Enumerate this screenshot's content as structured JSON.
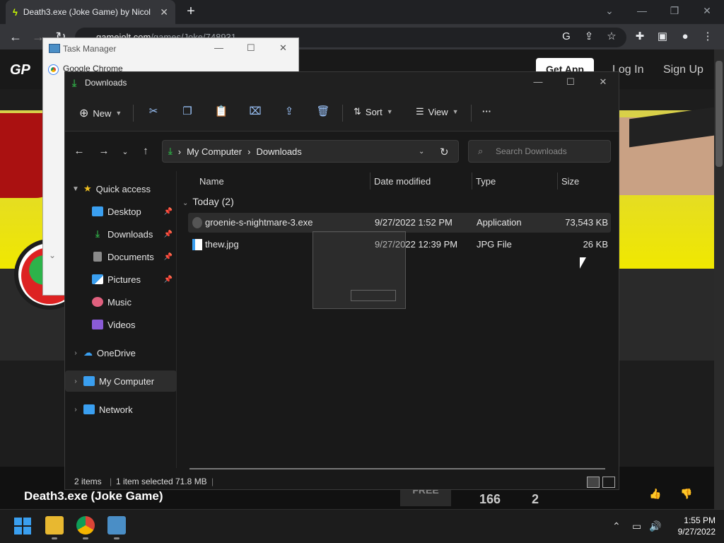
{
  "browser": {
    "tab_title": "Death3.exe (Joke Game) by Nicol",
    "tab_close": "✕",
    "new_tab": "+",
    "url_host": "gamejolt.com",
    "url_path": "/games/Joke/748931"
  },
  "webpage": {
    "logo": "GP",
    "get_app": "Get App",
    "log_in": "Log In",
    "sign_up": "Sign Up",
    "game_title": "Death3.exe (Joke Game)",
    "price_badge": "FREE",
    "stat_1": "166",
    "stat_2": "2"
  },
  "task_manager": {
    "title": "Task Manager",
    "row_1": "Google Chrome"
  },
  "explorer": {
    "title": "Downloads",
    "commands": {
      "new": "New",
      "sort": "Sort",
      "view": "View",
      "more": "···"
    },
    "address": {
      "segment_1": "My Computer",
      "segment_2": "Downloads",
      "separator": "›"
    },
    "search_placeholder": "Search Downloads",
    "sidebar": {
      "quick_access": "Quick access",
      "items": [
        {
          "label": "Desktop",
          "pinned": true,
          "color": "#3a9ff0"
        },
        {
          "label": "Downloads",
          "pinned": true,
          "color": "#2ea043"
        },
        {
          "label": "Documents",
          "pinned": true,
          "color": "#8a8a8a"
        },
        {
          "label": "Pictures",
          "pinned": true,
          "color": "#3a9ff0"
        },
        {
          "label": "Music",
          "pinned": false,
          "color": "#e0607e"
        },
        {
          "label": "Videos",
          "pinned": false,
          "color": "#8a5bd6"
        }
      ],
      "onedrive": "OneDrive",
      "my_computer": "My Computer",
      "network": "Network"
    },
    "columns": {
      "name": "Name",
      "date_modified": "Date modified",
      "type": "Type",
      "size": "Size"
    },
    "group_label": "Today (2)",
    "files": [
      {
        "name": "groenie-s-nightmare-3.exe",
        "date": "9/27/2022 1:52 PM",
        "type": "Application",
        "size": "73,543 KB",
        "selected": true
      },
      {
        "name": "thew.jpg",
        "date": "9/27/2022 12:39 PM",
        "type": "JPG File",
        "size": "26 KB",
        "selected": false
      }
    ],
    "status": {
      "items": "2 items",
      "selected": "1 item selected",
      "selected_size": "71.8 MB"
    }
  },
  "taskbar": {
    "time": "1:55 PM",
    "date": "9/27/2022"
  }
}
